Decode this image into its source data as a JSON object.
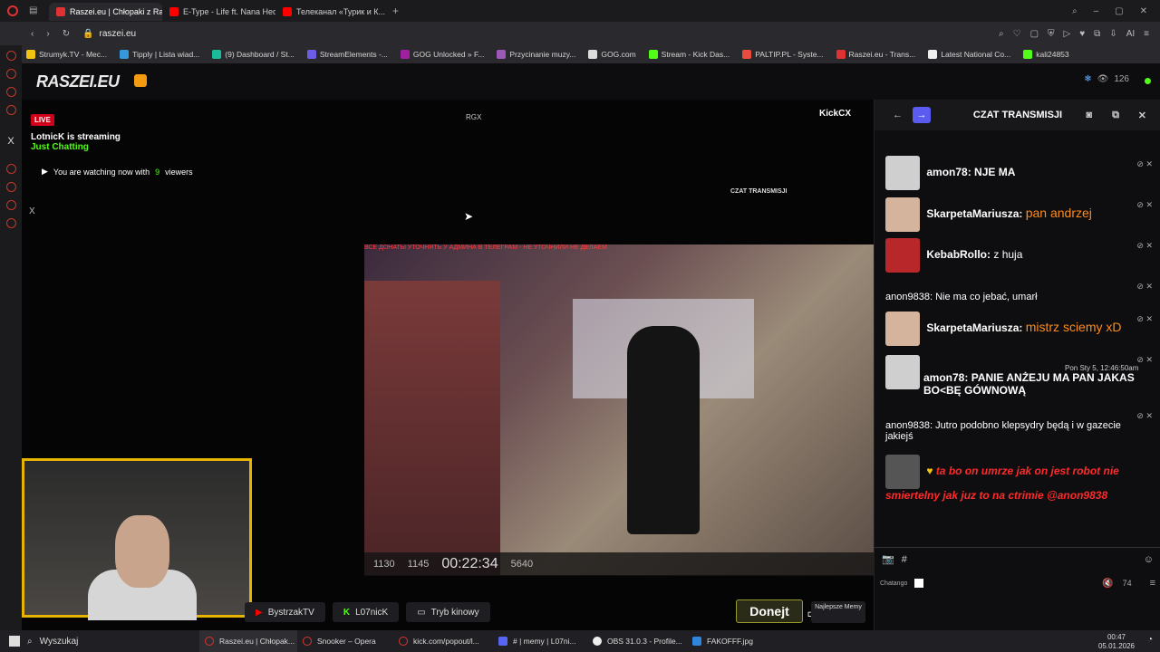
{
  "browser": {
    "tabs": [
      {
        "label": "Raszei.eu | Chłopaki z Raszei",
        "active": true
      },
      {
        "label": "E-Type - Life ft. Nana Hedin",
        "active": false
      },
      {
        "label": "Телеканал «Турик и К...",
        "active": false
      }
    ],
    "url": "raszei.eu",
    "bookmarks": [
      "Strumyk.TV - Mec...",
      "Tipply | Lista wiad...",
      "(9) Dashboard / St...",
      "StreamElements -...",
      "GOG Unlocked » F...",
      "Przycinanie muzy...",
      "GOG.com",
      "Stream - Kick Das...",
      "PALTIP.PL - Syste...",
      "Raszei.eu - Trans...",
      "Latest National Co...",
      "kali24853"
    ],
    "profile_label": "AI"
  },
  "site": {
    "logo": "RASZEI.EU",
    "viewer_count": "126"
  },
  "player": {
    "live_badge": "LIVE",
    "streamer_status": "LotnicK is streaming",
    "category": "Just Chatting",
    "watching_prefix": "You are watching now with",
    "watching_count": "9",
    "watching_suffix": "viewers",
    "inner_banner": "ВСЕ ДОНАТЫ УТОЧНЯТЬ У АДМИНА В ТЕЛЕГРАМ - НЕ УТОЧНИЛИ НЕ ДЕЛАЕМ",
    "inner_timer": "00:22:34",
    "inner_count_1": "1130",
    "inner_count_2": "1145",
    "inner_count_3": "5640",
    "inner_chat_title": "CZAT TRANSMISJI",
    "inner_logo": "KickCX",
    "inner_tag": "RGX"
  },
  "chat": {
    "title": "CZAT TRANSMISJI",
    "messages": [
      {
        "user": "amon78:",
        "text": "NJE MA",
        "style": "plain"
      },
      {
        "user": "SkarpetaMariusza:",
        "text": "pan andrzej",
        "style": "orange"
      },
      {
        "user": "KebabRollo:",
        "text": "z huja",
        "style": "plain"
      },
      {
        "user": "anon9838:",
        "text": "Nie ma co jebać, umarł",
        "style": "plain"
      },
      {
        "user": "SkarpetaMariusza:",
        "text": "mistrz sciemy xD",
        "style": "orange"
      },
      {
        "user": "amon78:",
        "text": "PANIE ANŻEJU MA PAN JAKAS BO<BĘ GÓWNOWĄ",
        "style": "plain",
        "timestamp": "Pon Sty 5, 12:46:50am"
      },
      {
        "user": "anon9838:",
        "text": "Jutro podobno klepsydry będą i w gazecie jakiejś",
        "style": "plain"
      },
      {
        "user": "",
        "text": "ta bo on umrze jak on jest robot nie smiertelny jak juz to na ctrimie @anon9838",
        "style": "red"
      }
    ],
    "input_hash": "#",
    "bottom_label": "Chatango",
    "volume": "74"
  },
  "page_buttons": {
    "bystrzak": "BystrzakTV",
    "l07nick": "L07nicK",
    "tryb": "Tryb kinowy",
    "donejt": "Donejt",
    "memy": "Najlepsze Memy"
  },
  "taskbar": {
    "search": "Wyszukaj",
    "items": [
      "Raszei.eu | Chłopak...",
      "Snooker – Opera",
      "kick.com/popout/l...",
      "# | memy | L07ni...",
      "OBS 31.0.3 - Profile...",
      "FAKOFFF.jpg"
    ],
    "time": "00:47",
    "date": "05.01.2026"
  },
  "colors": {
    "kick_green": "#53fc18",
    "live_red": "#d0021b",
    "chat_orange": "#ff8c1a",
    "chat_red": "#ff2a2a",
    "webcam_border": "#e6b400"
  }
}
